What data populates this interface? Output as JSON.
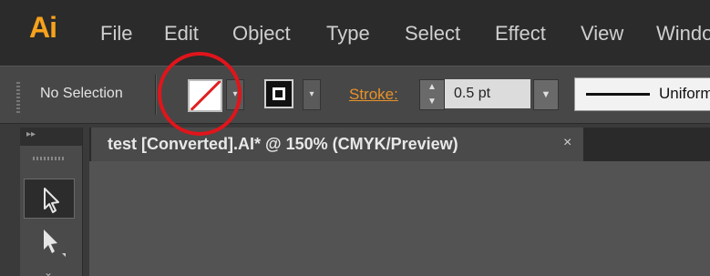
{
  "app": {
    "logo": "Ai",
    "accent": "#f7a21b"
  },
  "menu": {
    "items": [
      "File",
      "Edit",
      "Object",
      "Type",
      "Select",
      "Effect",
      "View",
      "Windo"
    ]
  },
  "control_bar": {
    "selection_status": "No Selection",
    "fill": {
      "icon": "none-swatch-icon",
      "dropdown": "▾"
    },
    "stroke_swatch": {
      "icon": "stroke-swatch-icon",
      "dropdown": "▾"
    },
    "stroke_label": "Stroke:",
    "stroke_up": "▲",
    "stroke_down": "▼",
    "stroke_weight": "0.5 pt",
    "stroke_dropdown": "▼",
    "profile": "Uniform"
  },
  "toolbar": {
    "collapse": "▸▸",
    "more": "⌄"
  },
  "document": {
    "tab_title": "test [Converted].AI* @ 150% (CMYK/Preview)",
    "close": "×"
  },
  "colors": {
    "annotation": "#e0151b",
    "stroke_label": "#e8922a"
  }
}
